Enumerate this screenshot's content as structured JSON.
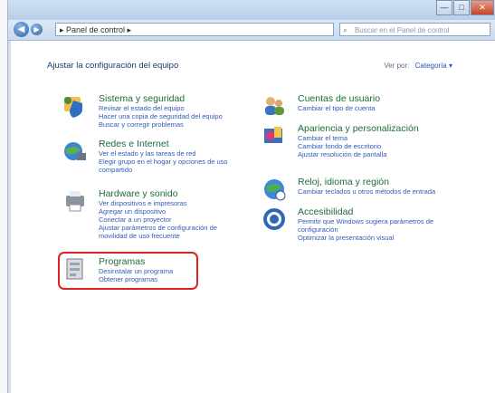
{
  "window": {
    "controls": [
      "—",
      "□",
      "✕"
    ]
  },
  "nav": {
    "back_icon": "back-arrow-icon",
    "forward_icon": "forward-arrow-icon",
    "address": "▸ Panel de control ▸",
    "search_placeholder": "Buscar en el Panel de control"
  },
  "content": {
    "heading": "Ajustar la configuración del equipo",
    "view_by_label": "Ver por:",
    "view_by_value": "Categoría ▾"
  },
  "categories": [
    {
      "title": "Sistema y seguridad",
      "links": [
        "Revisar el estado del equipo",
        "Hacer una copia de seguridad del equipo",
        "Buscar y corregir problemas"
      ],
      "icon": "shield-icon"
    },
    {
      "title": "Redes e Internet",
      "links": [
        "Ver el estado y las tareas de red",
        "Elegir grupo en el hogar y opciones de uso",
        "compartido"
      ],
      "icon": "globe-network-icon"
    },
    {
      "title": "Hardware y sonido",
      "links": [
        "Ver dispositivos e impresoras",
        "Agregar un dispositivo",
        "Conectar a un proyector",
        "Ajustar parámetros de configuración de",
        "movilidad de uso frecuente"
      ],
      "icon": "printer-icon"
    },
    {
      "title": "Programas",
      "links": [
        "Desinstalar un programa",
        "Obtener programas"
      ],
      "icon": "programs-icon"
    },
    {
      "title": "Cuentas de usuario",
      "links": [
        "Cambiar el tipo de cuenta"
      ],
      "icon": "users-icon"
    },
    {
      "title": "Apariencia y personalización",
      "links": [
        "Cambiar el tema",
        "Cambiar fondo de escritorio",
        "Ajustar resolución de pantalla"
      ],
      "icon": "appearance-icon"
    },
    {
      "title": "Reloj, idioma y región",
      "links": [
        "Cambiar teclados u otros métodos de entrada"
      ],
      "icon": "clock-globe-icon"
    },
    {
      "title": "Accesibilidad",
      "links": [
        "Permitir que Windows sugiera parámetros de",
        "configuración",
        "Optimizar la presentación visual"
      ],
      "icon": "accessibility-icon"
    }
  ]
}
